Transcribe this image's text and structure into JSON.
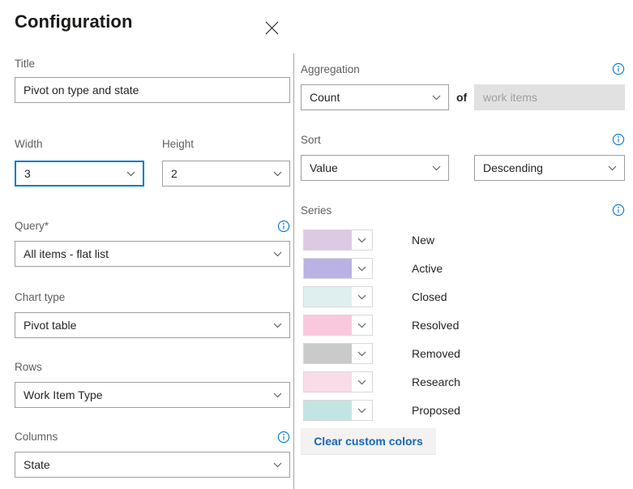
{
  "header": {
    "title": "Configuration",
    "close_icon": "close-icon"
  },
  "left_panel": {
    "title_field": {
      "label": "Title",
      "value": "Pivot on type and state"
    },
    "width_field": {
      "label": "Width",
      "value": "3"
    },
    "height_field": {
      "label": "Height",
      "value": "2"
    },
    "query_field": {
      "label": "Query*",
      "value": "All items - flat list",
      "info_icon": "info-icon"
    },
    "chart_type_field": {
      "label": "Chart type",
      "value": "Pivot table"
    },
    "rows_field": {
      "label": "Rows",
      "value": "Work Item Type"
    },
    "columns_field": {
      "label": "Columns",
      "value": "State",
      "info_icon": "info-icon"
    }
  },
  "right_panel": {
    "aggregation": {
      "label": "Aggregation",
      "value": "Count",
      "of_text": "of",
      "target_placeholder": "work items",
      "info_icon": "info-icon"
    },
    "sort": {
      "label": "Sort",
      "by_value": "Value",
      "direction_value": "Descending",
      "info_icon": "info-icon"
    },
    "series": {
      "label": "Series",
      "info_icon": "info-icon",
      "items": [
        {
          "label": "New",
          "color": "#ddc9e3"
        },
        {
          "label": "Active",
          "color": "#bab2e4"
        },
        {
          "label": "Closed",
          "color": "#dfefef"
        },
        {
          "label": "Resolved",
          "color": "#fac8dd"
        },
        {
          "label": "Removed",
          "color": "#cacaca"
        },
        {
          "label": "Research",
          "color": "#fadbe8"
        },
        {
          "label": "Proposed",
          "color": "#c2e5e4"
        }
      ],
      "clear_button_label": "Clear custom colors"
    }
  },
  "colors": {
    "accent": "#0078d4",
    "link": "#1667b5",
    "label": "#605e5c",
    "border": "#a19f9d",
    "disabled_bg": "#e1e1e1",
    "button_bg": "#f3f2f1"
  }
}
